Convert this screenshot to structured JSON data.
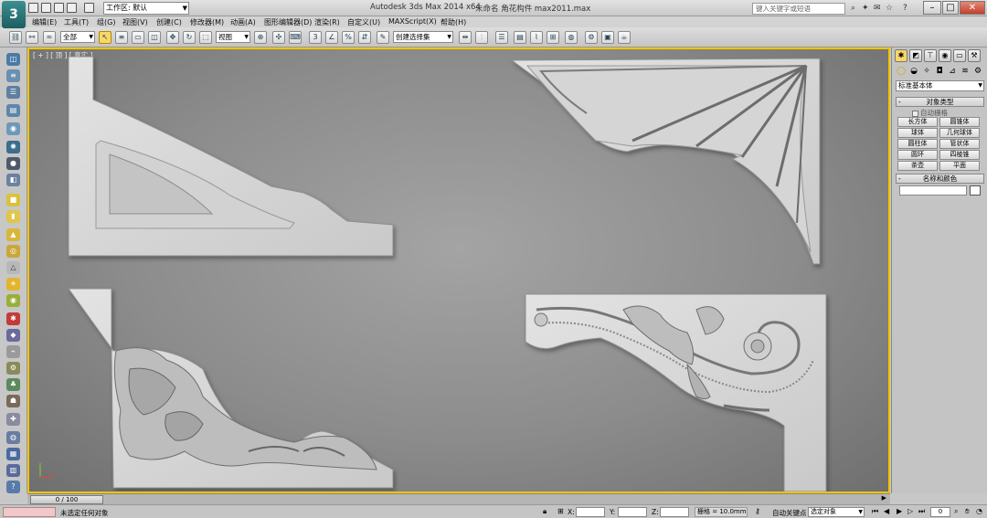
{
  "titlebar": {
    "workspace": "工作区: 默认",
    "app_title": "Autodesk 3ds Max  2014 x64",
    "file_title": "未命名 角花构件 max2011.max",
    "search_placeholder": "键入关键字或短语"
  },
  "menu": [
    "编辑(E)",
    "工具(T)",
    "组(G)",
    "视图(V)",
    "创建(C)",
    "修改器(M)",
    "动画(A)",
    "图形编辑器(D)",
    "渲染(R)",
    "自定义(U)",
    "MAXScript(X)",
    "帮助(H)"
  ],
  "toolbar": {
    "filter_select": "全部",
    "ref_coord": "视图",
    "selection_set": "创建选择集"
  },
  "viewport": {
    "label": "[ + ] [ 顶 ] [ 真实 ]",
    "axis_labels": [
      "y",
      "x"
    ]
  },
  "command_panel": {
    "dropdown": "标准基本体",
    "rollout_object_type": "对象类型",
    "autogrid": "自动栅格",
    "object_buttons": [
      "长方体",
      "圆锥体",
      "球体",
      "几何球体",
      "圆柱体",
      "管状体",
      "圆环",
      "四棱锥",
      "茶壶",
      "平面"
    ],
    "rollout_name_color": "名称和颜色"
  },
  "timeslider": {
    "frame_label": "0 / 100"
  },
  "statusbar": {
    "status_text": "未选定任何对象",
    "x_label": "X:",
    "y_label": "Y:",
    "z_label": "Z:",
    "grid_text": "栅格 = 10.0mm",
    "autokey_label": "自动关键点",
    "setkey_select": "选定对象",
    "current_frame": "0"
  }
}
